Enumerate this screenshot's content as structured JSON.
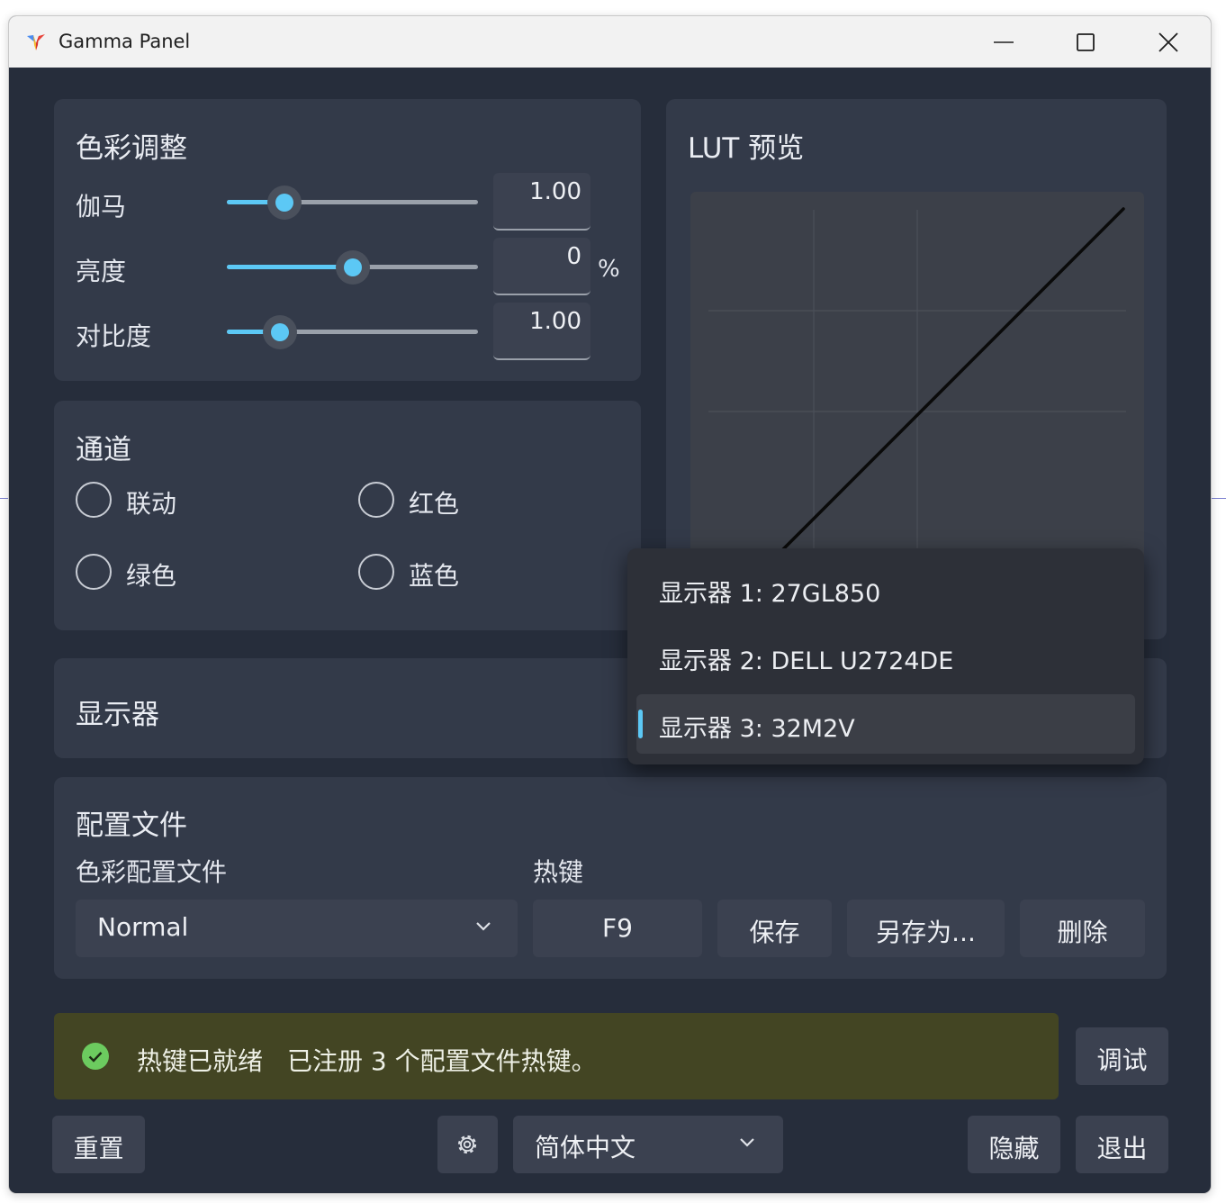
{
  "window": {
    "title": "Gamma Panel"
  },
  "color_adjust": {
    "title": "色彩调整",
    "gamma": {
      "label": "伽马",
      "value": "1.00",
      "level": 0.23
    },
    "brightness": {
      "label": "亮度",
      "value": "0",
      "unit": "%",
      "level": 0.5
    },
    "contrast": {
      "label": "对比度",
      "value": "1.00",
      "level": 0.21
    }
  },
  "channel": {
    "title": "通道",
    "options": [
      "联动",
      "红色",
      "绿色",
      "蓝色"
    ]
  },
  "lut": {
    "title": "LUT 预览"
  },
  "display": {
    "title": "显示器",
    "options": [
      "显示器 1: 27GL850",
      "显示器 2: DELL U2724DE",
      "显示器 3: 32M2V"
    ],
    "selected": "显示器 3: 32M2V"
  },
  "profiles": {
    "title": "配置文件",
    "profile_label": "色彩配置文件",
    "hotkey_label": "热键",
    "profile_value": "Normal",
    "hotkey_value": "F9",
    "save": "保存",
    "save_as": "另存为...",
    "delete": "删除"
  },
  "status": {
    "title": "热键已就绪",
    "message": "已注册 3 个配置文件热键。",
    "debug": "调试"
  },
  "footer": {
    "reset": "重置",
    "language": "简体中文",
    "hide": "隐藏",
    "exit": "退出"
  },
  "icons": {
    "app": "gamma-logo-icon",
    "settings": "gear-icon",
    "status": "check-circle-icon",
    "dropdown": "chevron-down-icon"
  },
  "colors": {
    "accent": "#5cc8f5",
    "success": "#6ccb5f",
    "window_bg": "#262d3b",
    "card_bg": "#333a49",
    "infobar_bg": "#434523"
  }
}
